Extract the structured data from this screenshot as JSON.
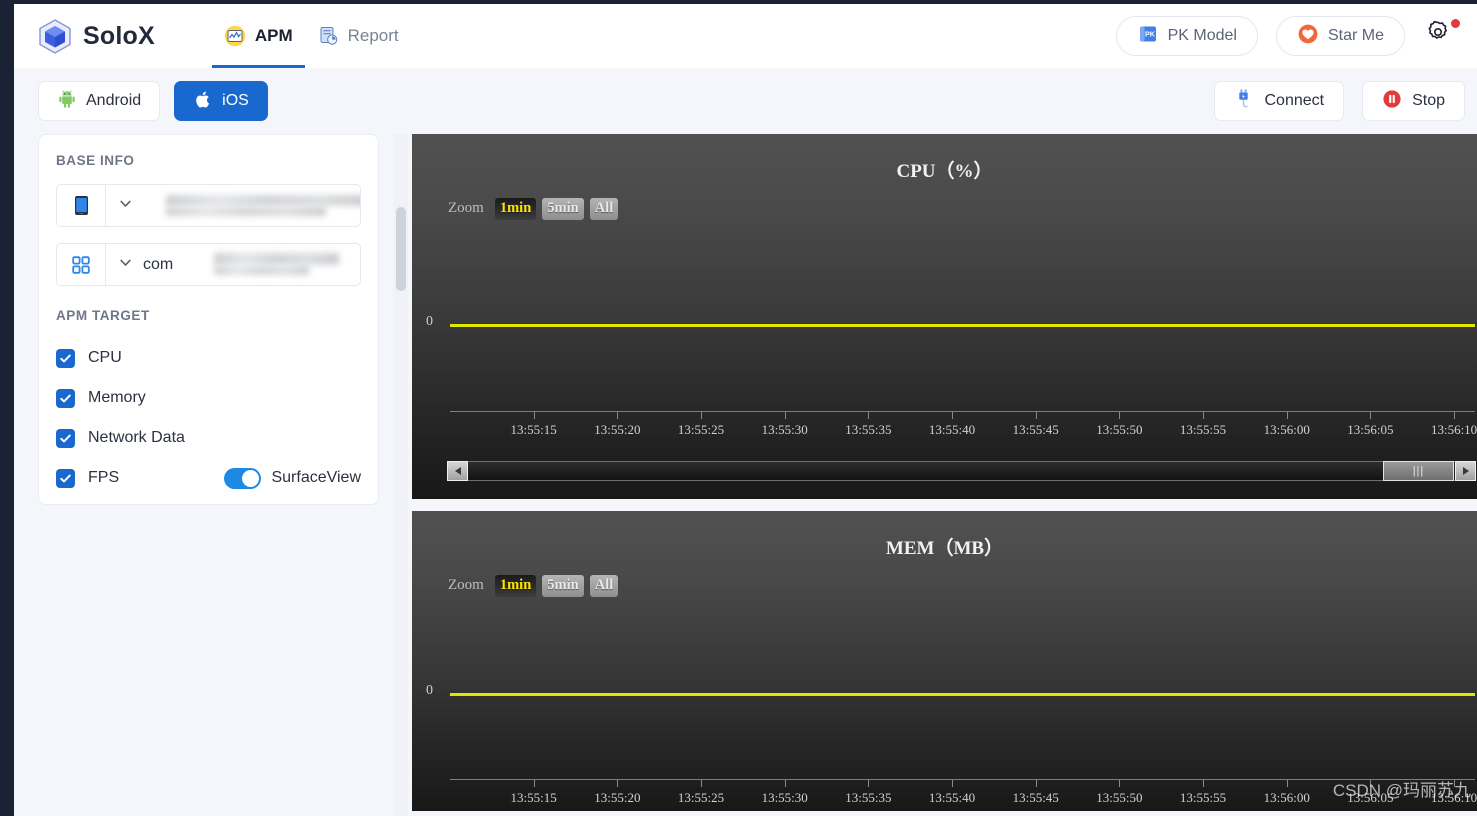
{
  "app": {
    "brand": "SoloX",
    "brand_logo_icon": "cube-logo-icon"
  },
  "nav": {
    "items": [
      {
        "label": "APM",
        "icon": "apm-monitor-icon",
        "active": true
      },
      {
        "label": "Report",
        "icon": "report-document-icon",
        "active": false
      }
    ]
  },
  "header_actions": {
    "pk_model": {
      "label": "PK Model",
      "icon": "pk-book-icon"
    },
    "star_me": {
      "label": "Star Me",
      "icon": "heart-star-icon"
    },
    "settings": {
      "icon": "gear-icon",
      "has_badge": true,
      "badge_color": "#e4393c"
    }
  },
  "toolbar": {
    "platforms": [
      {
        "label": "Android",
        "icon": "android-robot-icon",
        "selected": false
      },
      {
        "label": "iOS",
        "icon": "apple-icon",
        "selected": true
      }
    ],
    "connect": {
      "label": "Connect",
      "icon": "usb-plug-icon"
    },
    "stop": {
      "label": "Stop",
      "icon": "stop-pause-icon"
    }
  },
  "sidebar": {
    "base_info_title": "BASE INFO",
    "device_selector": {
      "icon": "phone-icon",
      "value": "",
      "redacted": true,
      "chevron": "chevron-down-icon"
    },
    "package_selector": {
      "icon": "apps-grid-icon",
      "value": "com",
      "redacted": true,
      "chevron": "chevron-down-icon"
    },
    "apm_target_title": "APM TARGET",
    "targets": [
      {
        "label": "CPU",
        "checked": true
      },
      {
        "label": "Memory",
        "checked": true
      },
      {
        "label": "Network Data",
        "checked": true
      },
      {
        "label": "FPS",
        "checked": true
      }
    ],
    "surfaceview": {
      "label": "SurfaceView",
      "on": true,
      "accent": "#1e88e5"
    }
  },
  "zoom_controls": {
    "label": "Zoom",
    "options": [
      "1min",
      "5min",
      "All"
    ],
    "selected": "1min",
    "selected_color": "#ffe500"
  },
  "chart_data": [
    {
      "type": "line",
      "title": "CPU（%）",
      "id": "cpu",
      "xlabel": "",
      "ylabel": "%",
      "ytick_labels": [
        "0"
      ],
      "ylim": [
        0,
        1
      ],
      "series": [
        {
          "name": "CPU",
          "color": "#e3e600",
          "values": [
            0,
            0,
            0,
            0,
            0,
            0,
            0,
            0,
            0,
            0,
            0,
            0
          ]
        }
      ],
      "x": [
        "13:55:15",
        "13:55:20",
        "13:55:25",
        "13:55:30",
        "13:55:35",
        "13:55:40",
        "13:55:45",
        "13:55:50",
        "13:55:55",
        "13:56:00",
        "13:56:05",
        "13:56:10"
      ],
      "grid": false,
      "legend": "none",
      "navigator": {
        "visible": true,
        "thumb_position": "right"
      }
    },
    {
      "type": "line",
      "title": "MEM（MB）",
      "id": "mem",
      "xlabel": "",
      "ylabel": "MB",
      "ytick_labels": [
        "0"
      ],
      "ylim": [
        0,
        1
      ],
      "series": [
        {
          "name": "MEM",
          "color": "#e3e600",
          "values": [
            0,
            0,
            0,
            0,
            0,
            0,
            0,
            0,
            0,
            0,
            0,
            0
          ]
        }
      ],
      "x": [
        "13:55:15",
        "13:55:20",
        "13:55:25",
        "13:55:30",
        "13:55:35",
        "13:55:40",
        "13:55:45",
        "13:55:50",
        "13:55:55",
        "13:56:00",
        "13:56:05",
        "13:56:10"
      ],
      "grid": false,
      "legend": "none",
      "navigator": {
        "visible": false
      }
    }
  ],
  "watermark": "CSDN @玛丽苏九"
}
